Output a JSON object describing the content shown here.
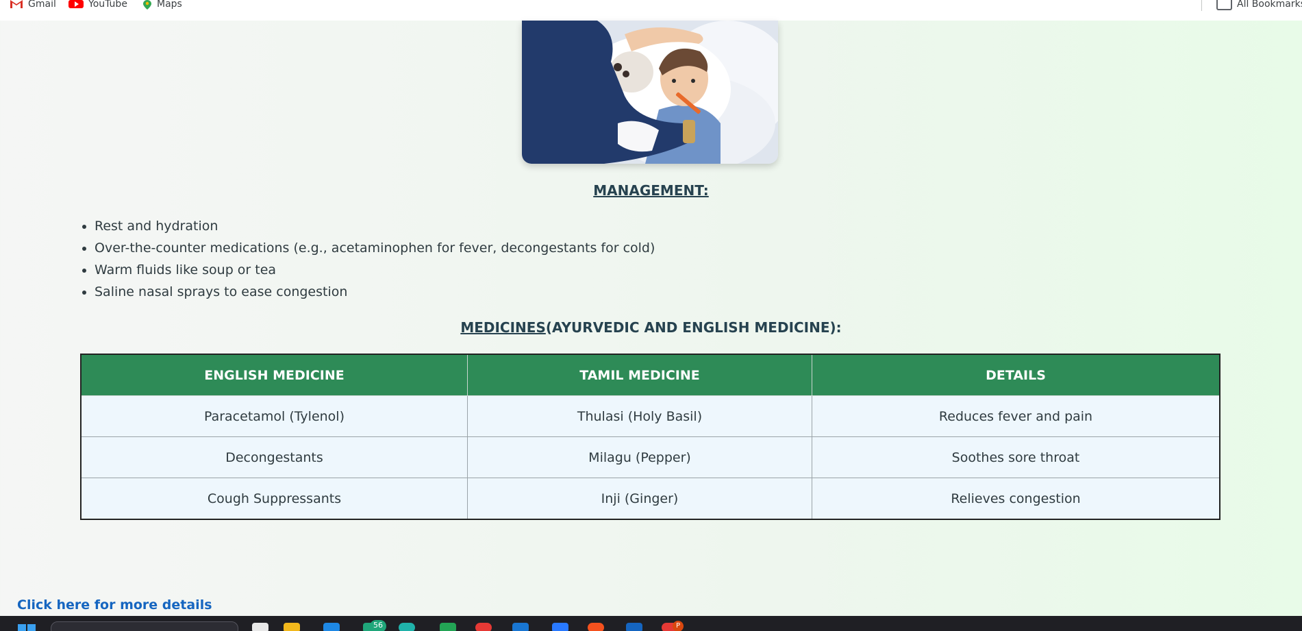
{
  "bookmarks": {
    "gmail": "Gmail",
    "youtube": "YouTube",
    "maps": "Maps",
    "all": "All Bookmarks"
  },
  "management": {
    "title": "MANAGEMENT:",
    "items": [
      "Rest and hydration",
      "Over-the-counter medications (e.g., acetaminophen for fever, decongestants for cold)",
      "Warm fluids like soup or tea",
      "Saline nasal sprays to ease congestion"
    ]
  },
  "medicines": {
    "title_underlined": "MEDICINES",
    "title_rest": "(AYURVEDIC AND ENGLISH MEDICINE):",
    "headers": [
      "ENGLISH MEDICINE",
      "TAMIL MEDICINE",
      "DETAILS"
    ],
    "rows": [
      [
        "Paracetamol (Tylenol)",
        "Thulasi (Holy Basil)",
        "Reduces fever and pain"
      ],
      [
        "Decongestants",
        "Milagu (Pepper)",
        "Soothes sore throat"
      ],
      [
        "Cough Suppressants",
        "Inji (Ginger)",
        "Relieves congestion"
      ]
    ]
  },
  "link": {
    "details": "Click here for more details"
  },
  "taskbar": {
    "badge_count": "56",
    "badge_letter": "P"
  },
  "colors": {
    "table_header": "#2e8b57",
    "link": "#1565c0",
    "title": "#26424f"
  }
}
